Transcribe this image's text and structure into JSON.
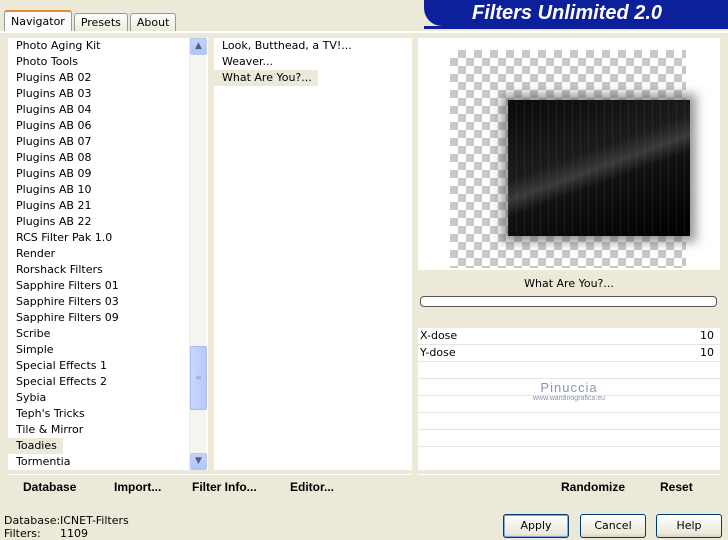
{
  "tabs": [
    "Navigator",
    "Presets",
    "About"
  ],
  "banner": "Filters Unlimited 2.0",
  "categories": [
    "Photo Aging Kit",
    "Photo Tools",
    "Plugins AB 02",
    "Plugins AB 03",
    "Plugins AB 04",
    "Plugins AB 06",
    "Plugins AB 07",
    "Plugins AB 08",
    "Plugins AB 09",
    "Plugins AB 10",
    "Plugins AB 21",
    "Plugins AB 22",
    "RCS Filter Pak 1.0",
    "Render",
    "Rorshack Filters",
    "Sapphire Filters 01",
    "Sapphire Filters 03",
    "Sapphire Filters 09",
    "Scribe",
    "Simple",
    "Special Effects 1",
    "Special Effects 2",
    "Sybia",
    "Teph's Tricks",
    "Tile & Mirror",
    "Toadies",
    "Tormentia"
  ],
  "filters": [
    "Look, Butthead, a TV!...",
    "Weaver...",
    "What Are You?..."
  ],
  "preview": {
    "filter_name": "What Are You?...",
    "params": [
      {
        "label": "X-dose",
        "value": "10"
      },
      {
        "label": "Y-dose",
        "value": "10"
      }
    ],
    "watermark_line1": "Pinuccia",
    "watermark_line2": "www.wardinografica.eu"
  },
  "toolbar": {
    "database": "Database",
    "import": "Import...",
    "filter_info": "Filter Info...",
    "editor": "Editor...",
    "randomize": "Randomize",
    "reset": "Reset"
  },
  "status": {
    "database_label": "Database:",
    "database_value": "ICNET-Filters",
    "filters_label": "Filters:",
    "filters_value": "1109"
  },
  "buttons": {
    "apply": "Apply",
    "cancel": "Cancel",
    "help": "Help"
  }
}
